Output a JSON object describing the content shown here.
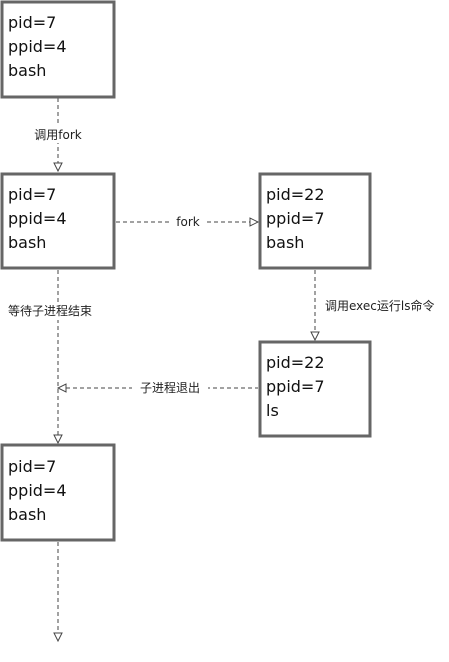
{
  "boxes": [
    {
      "id": "p1",
      "lines": [
        "pid=7",
        "ppid=4",
        "bash"
      ]
    },
    {
      "id": "p2",
      "lines": [
        "pid=7",
        "ppid=4",
        "bash"
      ]
    },
    {
      "id": "c1",
      "lines": [
        "pid=22",
        "ppid=7",
        "bash"
      ]
    },
    {
      "id": "c2",
      "lines": [
        "pid=22",
        "ppid=7",
        "ls"
      ]
    },
    {
      "id": "p3",
      "lines": [
        "pid=7",
        "ppid=4",
        "bash"
      ]
    }
  ],
  "edges": [
    {
      "id": "call-fork",
      "label": "调用fork"
    },
    {
      "id": "fork",
      "label": "fork"
    },
    {
      "id": "wait",
      "label": "等待子进程结束"
    },
    {
      "id": "exec",
      "label": "调用exec运行ls命令"
    },
    {
      "id": "child-exit",
      "label": "子进程退出"
    },
    {
      "id": "continue",
      "label": ""
    }
  ],
  "colors": {
    "box_border": "#666666",
    "line": "#444444",
    "text": "#111111"
  }
}
